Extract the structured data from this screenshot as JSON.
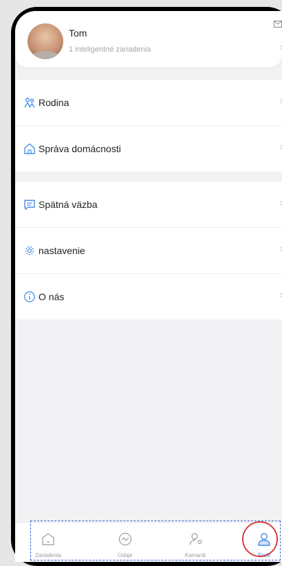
{
  "profile": {
    "name": "Tom",
    "devices": "1 inteligentné zariadenia"
  },
  "menu": {
    "group1": [
      {
        "label": "Rodina",
        "icon": "family-icon"
      },
      {
        "label": "Správa domácnosti",
        "icon": "home-icon"
      }
    ],
    "group2": [
      {
        "label": "Spätná väzba",
        "icon": "feedback-icon"
      },
      {
        "label": "nastavenie",
        "icon": "settings-gear-icon"
      },
      {
        "label": "O nás",
        "icon": "info-icon"
      }
    ]
  },
  "chevron": "›",
  "tabs": [
    {
      "label": "Zariadenia",
      "icon": "home-icon"
    },
    {
      "label": "Údaje",
      "icon": "activity-icon"
    },
    {
      "label": "Kamarát",
      "icon": "friend-icon"
    },
    {
      "label": "Profil",
      "icon": "person-icon",
      "active": true
    }
  ],
  "colors": {
    "accent": "#4a8ee8",
    "tab_inactive": "#9b9b9b",
    "annotation_box": "#3a5fd1",
    "annotation_circle": "#d83c3c"
  }
}
